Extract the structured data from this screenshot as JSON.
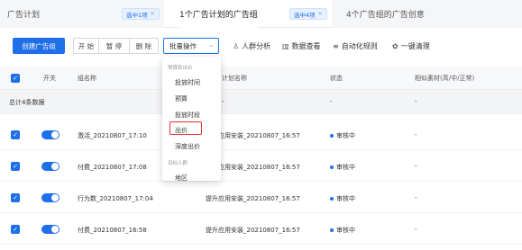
{
  "tabs": [
    {
      "title": "广告计划",
      "tag": "选中1项"
    },
    {
      "title": "1个广告计划的广告组",
      "tag": "选中4项"
    },
    {
      "title": "4个广告组的广告创意"
    }
  ],
  "toolbar": {
    "create_label": "创建广告组",
    "group": [
      "开 始",
      "暂 停",
      "删 除"
    ],
    "batch_select": "批量操作",
    "tools": [
      {
        "icon": "people-icon",
        "glyph": "♙",
        "label": "人群分析"
      },
      {
        "icon": "chart-icon",
        "glyph": "▥",
        "label": "数据查看"
      },
      {
        "icon": "rules-icon",
        "glyph": "≡",
        "label": "自动化规则"
      },
      {
        "icon": "clean-icon",
        "glyph": "✿",
        "label": "一键清理"
      }
    ]
  },
  "table": {
    "headers": {
      "switch": "开关",
      "name": "组名称",
      "plan": "计划名称",
      "status": "状态",
      "material": "相似素材(高/中/正常)"
    },
    "summary": {
      "label": "总计4条数据",
      "plan": "-",
      "status": "-",
      "material": "-"
    },
    "rows": [
      {
        "name": "激活_20210807_17:10",
        "plan": "提升应用安装_20210807_16:57",
        "status": "审核中",
        "material": "-"
      },
      {
        "name": "付费_20210807_17:08",
        "plan": "提升应用安装_20210807_16:57",
        "status": "审核中",
        "material": "-"
      },
      {
        "name": "行为数_20210807_17:04",
        "plan": "提升应用安装_20210807_16:57",
        "status": "审核中",
        "material": "-"
      },
      {
        "name": "付费_20210807_16:58",
        "plan": "提升应用安装_20210807_16:57",
        "status": "审核中",
        "material": "-"
      }
    ]
  },
  "dropdown": {
    "group1": "预算和出价",
    "items1": [
      "投放时间",
      "预算",
      "投放时段",
      "出价",
      "深度出价"
    ],
    "group2": "目标人群",
    "items2": [
      "地区"
    ]
  },
  "colors": {
    "accent": "#1e6fe8",
    "highlight": "#e0352b"
  }
}
